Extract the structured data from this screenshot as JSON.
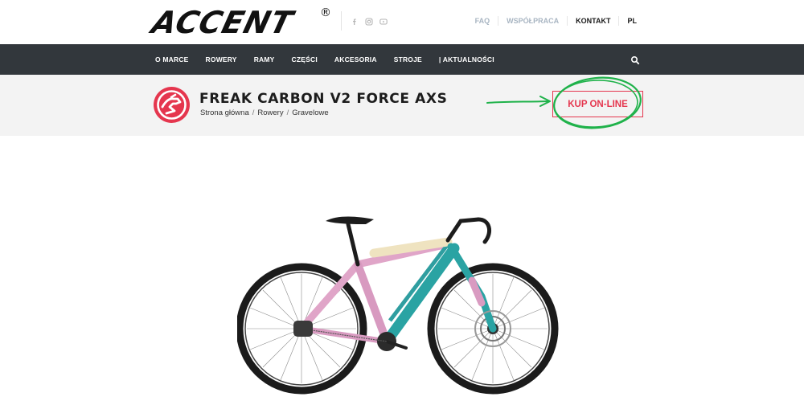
{
  "header": {
    "logo_text": "ACCENT",
    "logo_reg": "®",
    "social_icons": [
      "facebook-icon",
      "instagram-icon",
      "youtube-icon"
    ],
    "links": [
      {
        "label": "FAQ",
        "style": "light"
      },
      {
        "label": "WSPÓŁPRACA",
        "style": "light"
      },
      {
        "label": "KONTAKT",
        "style": "dark"
      },
      {
        "label": "PL",
        "style": "dark"
      }
    ]
  },
  "nav": {
    "items": [
      "O MARCE",
      "ROWERY",
      "RAMY",
      "CZĘŚCI",
      "AKCESORIA",
      "STROJE",
      "| AKTUALNOŚCI"
    ],
    "search_icon": "search-icon"
  },
  "product": {
    "title": "FREAK CARBON V2 FORCE AXS",
    "breadcrumb": [
      "Strona główna",
      "Rowery",
      "Gravelowe"
    ],
    "breadcrumb_sep": "/",
    "buy_label": "KUP ON-LINE",
    "category_icon": "gravel-bike-icon"
  },
  "colors": {
    "nav_bg": "#32373c",
    "accent_red": "#e5364e",
    "annotation_green": "#1fb24a",
    "title_band_bg": "#f3f3f3"
  }
}
